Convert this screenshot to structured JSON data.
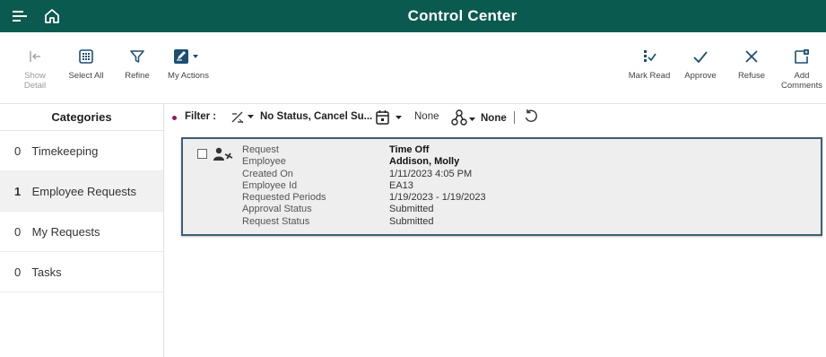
{
  "header": {
    "title": "Control Center"
  },
  "toolbar": {
    "show_detail": "Show Detail",
    "select_all": "Select All",
    "refine": "Refine",
    "my_actions": "My Actions",
    "mark_read": "Mark Read",
    "approve": "Approve",
    "refuse": "Refuse",
    "add_comments": "Add Comments"
  },
  "categories": {
    "title": "Categories",
    "items": [
      {
        "count": "0",
        "label": "Timekeeping",
        "active": false
      },
      {
        "count": "1",
        "label": "Employee Requests",
        "active": true
      },
      {
        "count": "0",
        "label": "My Requests",
        "active": false
      },
      {
        "count": "0",
        "label": "Tasks",
        "active": false
      }
    ]
  },
  "filter": {
    "label": "Filter :",
    "status": "No Status, Cancel Su...",
    "date": "None",
    "group": "None"
  },
  "request": {
    "labels": [
      "Request",
      "Employee",
      "Created On",
      "Employee Id",
      "Requested Periods",
      "Approval Status",
      "Request Status"
    ],
    "values": [
      "Time Off",
      "Addison, Molly",
      "1/11/2023 4:05 PM",
      "EA13",
      "1/19/2023 - 1/19/2023",
      "Submitted",
      "Submitted"
    ]
  },
  "colors": {
    "header_bg": "#0b5a4f",
    "accent": "#1b4f72",
    "card_border": "#3f5d74",
    "filter_dot": "#8a1a6a"
  }
}
